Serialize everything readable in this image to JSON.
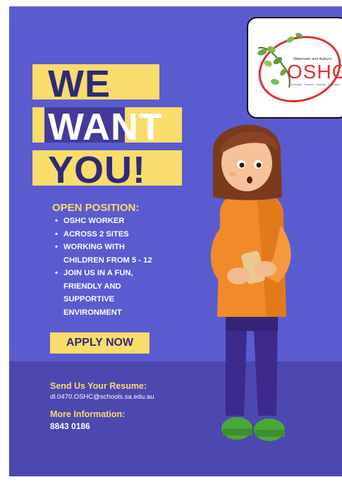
{
  "logo": {
    "name": "OSHC",
    "subtitle": "Watervale and Auburn",
    "tagline": "Community · Respect · Learning · Happiness"
  },
  "headline": {
    "line1": "WE",
    "line2_a": "WA",
    "line2_b": "NT",
    "line3": "YOU!"
  },
  "position": {
    "title": "OPEN POSITION:",
    "items": [
      "OSHC WORKER",
      "ACROSS 2 SITES",
      "WORKING WITH",
      "CHILDREN FROM 5 - 12",
      "JOIN US IN A FUN,",
      "FRIENDLY AND",
      "SUPPORTIVE",
      "ENVIRONMENT"
    ]
  },
  "apply_label": "APPLY NOW",
  "contact": {
    "resume_title": "Send Us Your Resume:",
    "email": "dl.0470.OSHC@schools.sa.edu.au",
    "info_title": "More Information:",
    "phone": "8843 0186"
  },
  "colors": {
    "background": "#5b5bd0",
    "accent": "#f8dc6c",
    "headline_text": "#2e2a78",
    "sweater": "#f08a2a",
    "pants": "#3d2a8c",
    "shoes": "#4aa83a"
  }
}
